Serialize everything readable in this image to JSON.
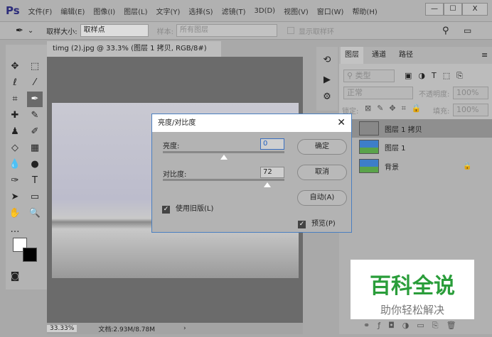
{
  "app": {
    "logo": "Ps",
    "menu": [
      "文件(F)",
      "编辑(E)",
      "图像(I)",
      "图层(L)",
      "文字(Y)",
      "选择(S)",
      "滤镜(T)",
      "3D(D)",
      "视图(V)",
      "窗口(W)",
      "帮助(H)"
    ],
    "win": [
      "—",
      "☐",
      "X"
    ]
  },
  "options": {
    "sample_size_label": "取样大小:",
    "sample_size_value": "取样点",
    "sample_label": "样本:",
    "sample_value": "所有图层",
    "show_ring": "显示取样环"
  },
  "document": {
    "tab": "timg (2).jpg @ 33.3% (图层 1 拷贝, RGB/8#) *",
    "zoom": "33.33%",
    "doc_info": "文档:2.93M/8.78M"
  },
  "layers_panel": {
    "tabs": [
      "图层",
      "通道",
      "路径"
    ],
    "filter": "类型",
    "blend_mode": "正常",
    "opacity_label": "不透明度:",
    "opacity": "100%",
    "lock_label": "锁定:",
    "fill_label": "填充:",
    "fill": "100%",
    "layers": [
      {
        "name": "图层 1 拷贝",
        "selected": true
      },
      {
        "name": "图层 1"
      },
      {
        "name": "背景",
        "locked": true
      }
    ]
  },
  "dialog": {
    "title": "亮度/对比度",
    "brightness_label": "亮度:",
    "brightness": "0",
    "contrast_label": "对比度:",
    "contrast": "72",
    "ok": "确定",
    "cancel": "取消",
    "auto": "自动(A)",
    "legacy": "使用旧版(L)",
    "preview": "预览(P)",
    "brightness_fraction": 0.5,
    "contrast_fraction": 0.86
  },
  "watermark": {
    "title": "百科全说",
    "subtitle": "助你轻松解决"
  }
}
